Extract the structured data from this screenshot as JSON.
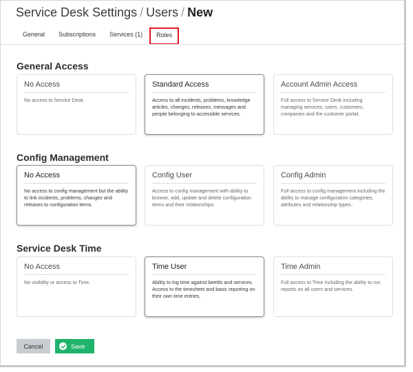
{
  "breadcrumb": {
    "part1": "Service Desk Settings",
    "sep": "/",
    "part2": "Users",
    "current": "New"
  },
  "tabs": [
    {
      "label": "General"
    },
    {
      "label": "Subscriptions"
    },
    {
      "label": "Services (1)"
    },
    {
      "label": "Roles",
      "active": true
    }
  ],
  "sections": {
    "general": {
      "title": "General Access",
      "cards": [
        {
          "title": "No Access",
          "desc": "No access to Service Desk."
        },
        {
          "title": "Standard Access",
          "desc": "Access to all incidents, problems, knowledge articles, changes, releases, messages and people belonging to accessible services.",
          "selected": true
        },
        {
          "title": "Account Admin Access",
          "desc": "Full access to Service Desk including managing services, users, customers, companies and the customer portal."
        }
      ]
    },
    "config": {
      "title": "Config Management",
      "cards": [
        {
          "title": "No Access",
          "desc": "No access to config management but the ability to link incidents, problems, changes and releases to configuration items.",
          "selected": true
        },
        {
          "title": "Config User",
          "desc": "Access to config management with ability to browse, add, update and delete configuration items and their relationships."
        },
        {
          "title": "Config Admin",
          "desc": "Full access to config management including the ability to manage configuration categories, attributes and relationship types."
        }
      ]
    },
    "time": {
      "title": "Service Desk Time",
      "cards": [
        {
          "title": "No Access",
          "desc": "No visibility or access to Time."
        },
        {
          "title": "Time User",
          "desc": "Ability to log time against beetils and services. Access to the timesheet and basic reporting on their own time entries.",
          "selected": true
        },
        {
          "title": "Time Admin",
          "desc": "Full access to Time including the ability to run reports on all users and services."
        }
      ]
    }
  },
  "buttons": {
    "cancel": "Cancel",
    "save": "Save"
  },
  "colors": {
    "tab_highlight": "#e0141e",
    "save_button": "#20b36b",
    "cancel_button": "#c9ccd0"
  }
}
